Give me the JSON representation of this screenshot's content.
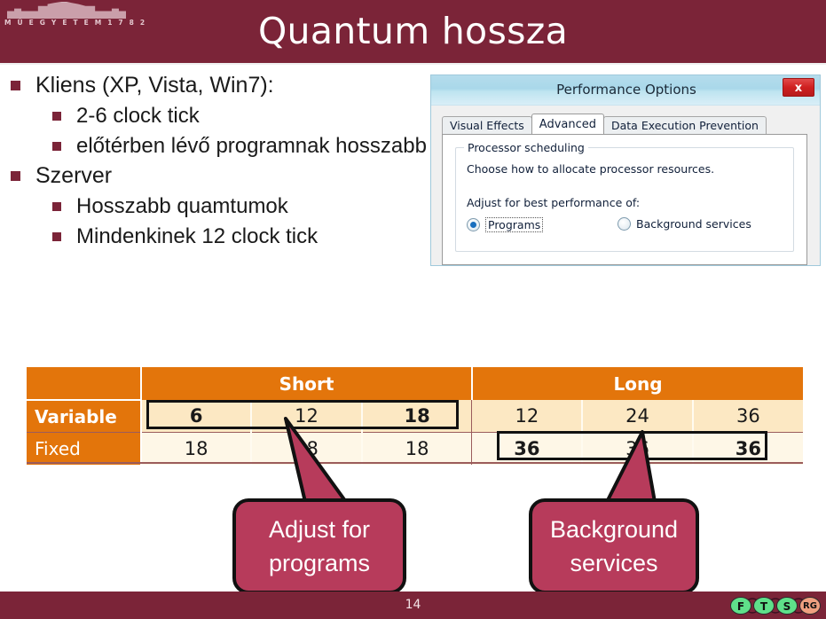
{
  "slide": {
    "title": "Quantum hossza",
    "page_number": "14",
    "accent_dark": "#7B2438",
    "accent_orange": "#E3750B",
    "callout_fill": "#B73B5B"
  },
  "bullets": [
    {
      "level": 1,
      "text": "Kliens (XP, Vista, Win7):"
    },
    {
      "level": 2,
      "text": "2-6 clock tick"
    },
    {
      "level": 2,
      "text": "előtérben lévő programnak hosszabb"
    },
    {
      "level": 1,
      "text": "Szerver"
    },
    {
      "level": 2,
      "text": "Hosszabb quamtumok"
    },
    {
      "level": 2,
      "text": "Mindenkinek 12 clock tick"
    }
  ],
  "dialog": {
    "title": "Performance Options",
    "close_label": "x",
    "tabs": [
      {
        "label": "Visual Effects",
        "active": false
      },
      {
        "label": "Advanced",
        "active": true
      },
      {
        "label": "Data Execution Prevention",
        "active": false
      }
    ],
    "group": {
      "legend": "Processor scheduling",
      "line1": "Choose how to allocate processor resources.",
      "line2": "Adjust for best performance of:",
      "options": [
        {
          "label": "Programs",
          "checked": true
        },
        {
          "label": "Background services",
          "checked": false
        }
      ]
    }
  },
  "table": {
    "corner": "",
    "group_headers": [
      "Short",
      "Long"
    ],
    "rows": [
      {
        "label": "Variable",
        "short": [
          "6",
          "12",
          "18"
        ],
        "long": [
          "12",
          "24",
          "36"
        ],
        "bold_short": [
          true,
          false,
          true
        ],
        "bold_long": [
          false,
          false,
          false
        ]
      },
      {
        "label": "Fixed",
        "short": [
          "18",
          "18",
          "18"
        ],
        "long": [
          "36",
          "36",
          "36"
        ],
        "bold_short": [
          false,
          false,
          false
        ],
        "bold_long": [
          true,
          false,
          true
        ]
      }
    ]
  },
  "callouts": [
    {
      "id": "adjust",
      "line1": "Adjust for",
      "line2": "programs"
    },
    {
      "id": "background",
      "line1": "Background",
      "line2": "services"
    }
  ],
  "footer": {
    "university_caption": "M Ű E G Y E T E M   1 7 8 2",
    "research_group_nodes": [
      "F",
      "T",
      "S",
      "RG"
    ]
  }
}
